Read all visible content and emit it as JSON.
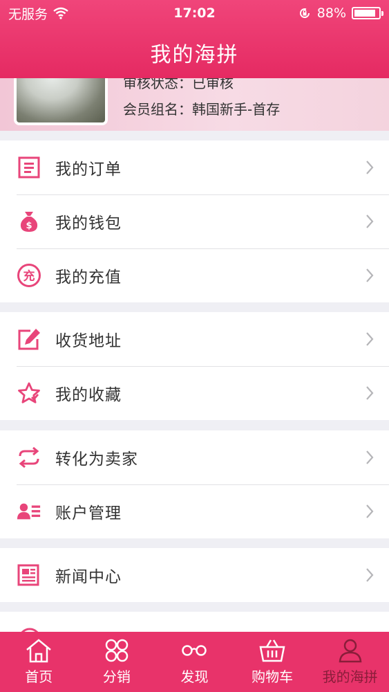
{
  "status": {
    "carrier": "无服务",
    "time": "17:02",
    "battery": "88%",
    "battery_level": 0.88
  },
  "nav": {
    "title": "我的海拼"
  },
  "profile": {
    "audit": "审核状态：已审核",
    "group": "会员组名：韩国新手-首存"
  },
  "menu": {
    "orders": "我的订单",
    "wallet": "我的钱包",
    "recharge": "我的充值",
    "address": "收货地址",
    "favorites": "我的收藏",
    "seller": "转化为卖家",
    "account": "账户管理",
    "news": "新闻中心"
  },
  "tabs": {
    "home": "首页",
    "distribution": "分销",
    "discover": "发现",
    "cart": "购物车",
    "mine": "我的海拼"
  },
  "colors": {
    "accent": "#e8336a",
    "icon": "#e8457a",
    "tab_active": "#8a1d3a"
  }
}
